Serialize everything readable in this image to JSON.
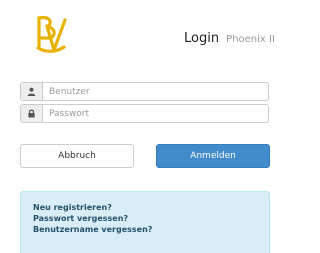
{
  "header": {
    "logo_text": "BV",
    "title": "Login",
    "subtitle": "Phoenix II"
  },
  "form": {
    "username": {
      "icon": "user-icon",
      "value": "",
      "placeholder": "Benutzer"
    },
    "password": {
      "icon": "lock-icon",
      "value": "",
      "placeholder": "Passwort"
    }
  },
  "buttons": {
    "cancel_label": "Abbruch",
    "login_label": "Anmelden"
  },
  "help_links": [
    "Neu registrieren?",
    "Passwort vergessen?",
    "Benutzername vergessen?"
  ],
  "colors": {
    "brand_gold": "#e9b200",
    "primary": "#428bca",
    "info_bg": "#d9edf7",
    "info_text": "#245269"
  }
}
